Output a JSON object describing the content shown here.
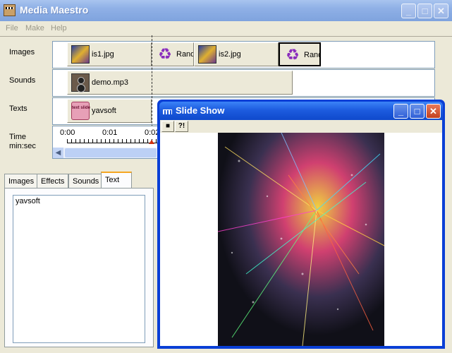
{
  "window": {
    "title": "Media Maestro",
    "minimize": "_",
    "maximize": "□",
    "close": "✕"
  },
  "menu": [
    "File",
    "Make",
    "Help"
  ],
  "timeline": {
    "row_labels": {
      "images": "Images",
      "sounds": "Sounds",
      "texts": "Texts",
      "time": "Time",
      "time_unit": "min:sec"
    },
    "images": [
      {
        "label": "is1.jpg",
        "icon": "picture-icon"
      },
      {
        "label": "Rand",
        "icon": "random-icon"
      },
      {
        "label": "is2.jpg",
        "icon": "picture-icon"
      },
      {
        "label": "Rand",
        "icon": "random-icon"
      }
    ],
    "sounds": [
      {
        "label": "demo.mp3",
        "icon": "speaker-icon"
      }
    ],
    "texts": [
      {
        "label": "yavsoft",
        "icon": "text-slide-icon",
        "icon_text": "text slide"
      }
    ],
    "ticks": [
      "0:00",
      "0:01",
      "0:02"
    ]
  },
  "tabs": [
    "Images",
    "Effects",
    "Sounds",
    "Text"
  ],
  "active_tab": "Text",
  "text_content": "yavsoft",
  "slideshow": {
    "title": "Slide Show",
    "stop": "■",
    "help": "?!",
    "minimize": "_",
    "maximize": "□",
    "close": "✕"
  },
  "colors": {
    "titlebar_active": "#1d5cdf",
    "titlebar_inactive": "#8fb0e6",
    "window_bg": "#ece9d8"
  }
}
